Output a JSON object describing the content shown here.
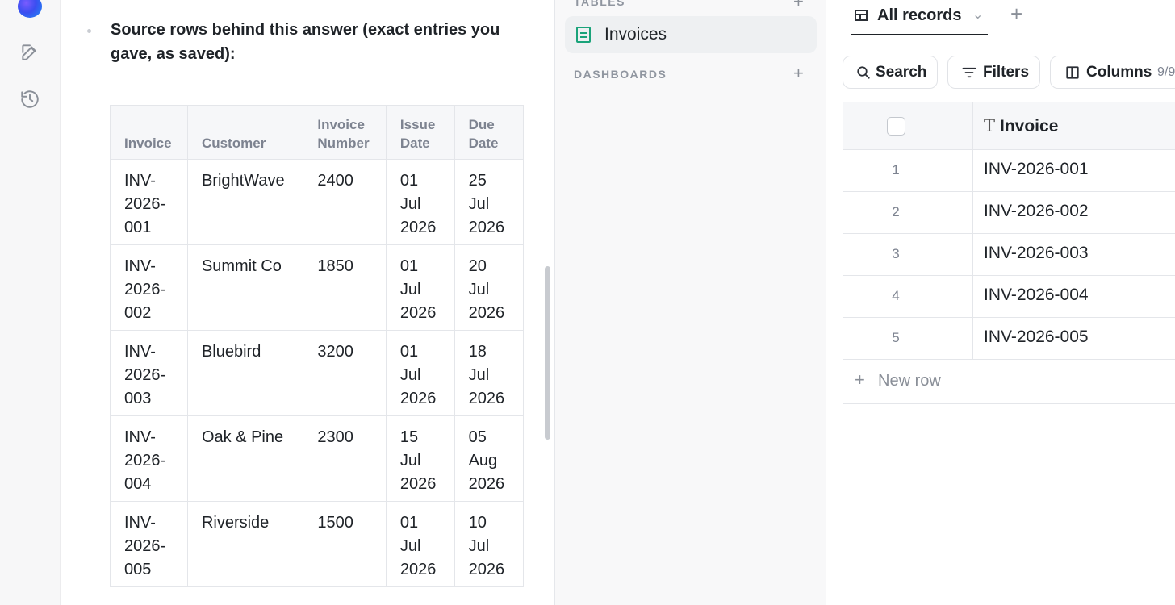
{
  "chat": {
    "bullet": "Source rows behind this answer (exact entries you gave, as saved):",
    "table": {
      "headers": [
        [
          "Invoice"
        ],
        [
          "Customer"
        ],
        [
          "Invoice",
          "Number"
        ],
        [
          "Issue",
          "Date"
        ],
        [
          "Due",
          "Date"
        ]
      ],
      "rows": [
        {
          "invoice": [
            "INV-",
            "2026-",
            "001"
          ],
          "customer": "BrightWave",
          "number": "2400",
          "issue": [
            "01",
            "Jul",
            "2026"
          ],
          "due": [
            "25",
            "Jul",
            "2026"
          ]
        },
        {
          "invoice": [
            "INV-",
            "2026-",
            "002"
          ],
          "customer": "Summit Co",
          "number": "1850",
          "issue": [
            "01",
            "Jul",
            "2026"
          ],
          "due": [
            "20",
            "Jul",
            "2026"
          ]
        },
        {
          "invoice": [
            "INV-",
            "2026-",
            "003"
          ],
          "customer": "Bluebird",
          "number": "3200",
          "issue": [
            "01",
            "Jul",
            "2026"
          ],
          "due": [
            "18",
            "Jul",
            "2026"
          ]
        },
        {
          "invoice": [
            "INV-",
            "2026-",
            "004"
          ],
          "customer": "Oak & Pine",
          "number": "2300",
          "issue": [
            "15",
            "Jul",
            "2026"
          ],
          "due": [
            "05",
            "Aug",
            "2026"
          ]
        },
        {
          "invoice": [
            "INV-",
            "2026-",
            "005"
          ],
          "customer": "Riverside",
          "number": "1500",
          "issue": [
            "01",
            "Jul",
            "2026"
          ],
          "due": [
            "10",
            "Jul",
            "2026"
          ]
        }
      ]
    }
  },
  "sidebar": {
    "tables_label": "TABLES",
    "tables": [
      {
        "label": "Invoices",
        "icon": "document-icon"
      }
    ],
    "dashboards_label": "DASHBOARDS",
    "add_glyph": "+"
  },
  "data_view": {
    "tab_label": "All records",
    "tab_chevron": "⌄",
    "add_tab_glyph": "+",
    "toolbar": {
      "search_label": "Search",
      "filters_label": "Filters",
      "columns_label": "Columns",
      "columns_count": "9/9"
    },
    "column_header": "Invoice",
    "column_type_glyph": "T",
    "rows": [
      {
        "num": "1",
        "invoice": "INV-2026-001"
      },
      {
        "num": "2",
        "invoice": "INV-2026-002"
      },
      {
        "num": "3",
        "invoice": "INV-2026-003"
      },
      {
        "num": "4",
        "invoice": "INV-2026-004"
      },
      {
        "num": "5",
        "invoice": "INV-2026-005"
      }
    ],
    "new_row_label": "New row",
    "new_row_glyph": "+"
  },
  "colors": {
    "accent_green": "#1aa37a",
    "text": "#1f2328",
    "muted": "#8a8f98"
  }
}
